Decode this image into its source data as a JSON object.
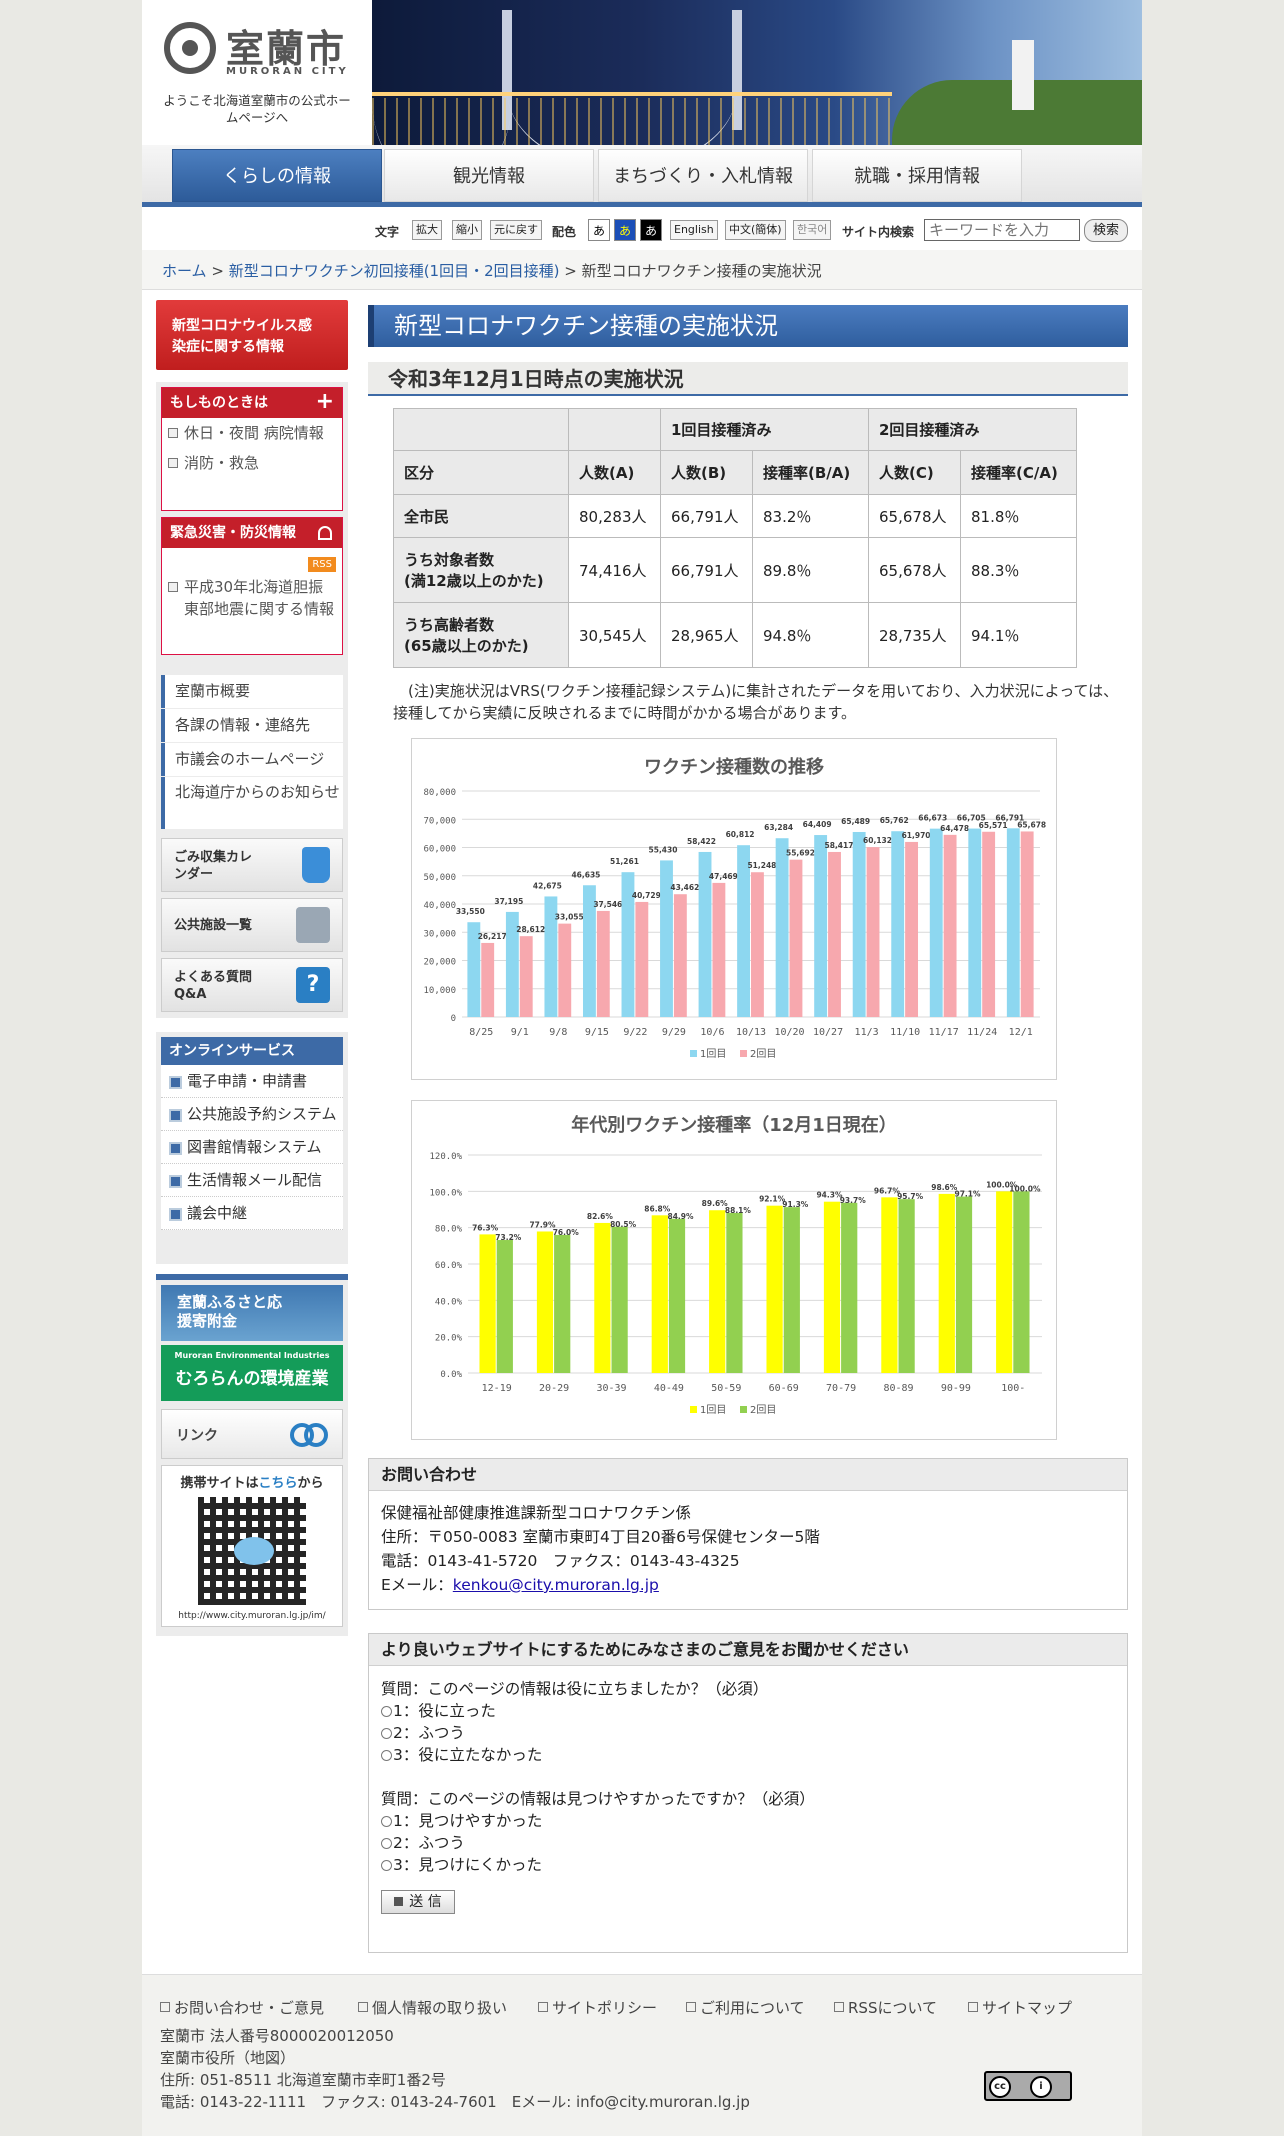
{
  "site": {
    "name": "室蘭市",
    "name_en": "MURORAN CITY",
    "welcome": "ようこそ北海道室蘭市の公式ホームページへ"
  },
  "gnav": [
    "くらしの情報",
    "観光情報",
    "まちづくり・入札情報",
    "就職・採用情報"
  ],
  "utility": {
    "text_label": "文字",
    "enlarge": "拡大",
    "shrink": "縮小",
    "reset": "元に戻す",
    "color_label": "配色",
    "color_options": [
      "あ",
      "あ",
      "あ"
    ],
    "english": "English",
    "chinese": "中文(簡体)",
    "korean": "한국어",
    "search_label": "サイト内検索",
    "search_placeholder": "キーワードを入力",
    "search_button": "検索"
  },
  "breadcrumb": {
    "home": "ホーム",
    "parent": "新型コロナワクチン初回接種(1回目・2回目接種)",
    "current": "新型コロナワクチン接種の実施状況",
    "sep": ">"
  },
  "sidebar": {
    "corona_banner": "新型コロナウイルス感染症に関する情報",
    "emergency_head": "もしものときは",
    "emergency_links": [
      "休日・夜間 病院情報",
      "消防・救急"
    ],
    "disaster_head": "緊急災害・防災情報",
    "rss": "RSS",
    "disaster_links": [
      "平成30年北海道胆振東部地震に関する情報"
    ],
    "menu": [
      "室蘭市概要",
      "各課の情報・連絡先",
      "市議会のホームページ",
      "北海道庁からのお知らせ"
    ],
    "banners": [
      "ごみ収集カレンダー",
      "公共施設一覧",
      "よくある質問Q&A"
    ],
    "online_head": "オンラインサービス",
    "online_links": [
      "電子申請・申請書",
      "公共施設予約システム",
      "図書館情報システム",
      "生活情報メール配信",
      "議会中継"
    ],
    "furusato": "室蘭ふるさと応援寄附金",
    "env_small": "Muroran Environmental Industries",
    "env_big": "むろらんの環境産業",
    "link_label": "リンク",
    "mobile_label_1": "携帯サイトは",
    "mobile_label_2": "こちら",
    "mobile_label_3": "から",
    "mobile_url": "http://www.city.muroran.lg.jp/im/"
  },
  "main": {
    "title": "新型コロナワクチン接種の実施状況",
    "subtitle": "令和3年12月1日時点の実施状況",
    "table": {
      "group_headers": [
        "1回目接種済み",
        "2回目接種済み"
      ],
      "headers": [
        "区分",
        "人数(A)",
        "人数(B)",
        "接種率(B/A)",
        "人数(C)",
        "接種率(C/A)"
      ],
      "rows": [
        {
          "label": "全市民",
          "sub": "",
          "cells": [
            "80,283人",
            "66,791人",
            "83.2％",
            "65,678人",
            "81.8％"
          ]
        },
        {
          "label": "うち対象者数",
          "sub": "(満12歳以上のかた)",
          "cells": [
            "74,416人",
            "66,791人",
            "89.8％",
            "65,678人",
            "88.3％"
          ]
        },
        {
          "label": "うち高齢者数",
          "sub": "(65歳以上のかた)",
          "cells": [
            "30,545人",
            "28,965人",
            "94.8％",
            "28,735人",
            "94.1％"
          ]
        }
      ]
    },
    "note": "(注)実施状況はVRS(ワクチン接種記録システム)に集計されたデータを用いており、入力状況によっては、接種してから実績に反映されるまでに時間がかかる場合があります。"
  },
  "contact": {
    "head": "お問い合わせ",
    "dept": "保健福祉部健康推進課新型コロナワクチン係",
    "address": "住所：〒050-0083 室蘭市東町4丁目20番6号保健センター5階",
    "phone": "電話：0143-41-5720　ファクス：0143-43-4325",
    "email_label": "Eメール：",
    "email": "kenkou@city.muroran.lg.jp"
  },
  "survey": {
    "head": "より良いウェブサイトにするためにみなさまのご意見をお聞かせください",
    "q1": "質問：このページの情報は役に立ちましたか？（必須）",
    "q1_options": [
      "1：役に立った",
      "2：ふつう",
      "3：役に立たなかった"
    ],
    "q2": "質問：このページの情報は見つけやすかったですか？（必須）",
    "q2_options": [
      "1：見つけやすかった",
      "2：ふつう",
      "3：見つけにくかった"
    ],
    "submit": "送 信"
  },
  "footer": {
    "links": [
      "お問い合わせ・ご意見",
      "個人情報の取り扱い",
      "サイトポリシー",
      "ご利用について",
      "RSSについて",
      "サイトマップ"
    ],
    "corp_no": "室蘭市 法人番号8000020012050",
    "office": "室蘭市役所（地図）",
    "address": "住所: 051-8511 北海道室蘭市幸町1番2号",
    "phone": "電話: 0143-22-1111　ファクス: 0143-24-7601　Eメール: info@city.muroran.lg.jp"
  },
  "colors": {
    "accent": "#3d6aa6",
    "alert": "#c41f2a",
    "bar1_cyan": "#8dd7f0",
    "bar2_pink": "#f7a8ae",
    "bar1_yellow": "#ffff00",
    "bar2_green": "#92d050"
  },
  "chart_data": [
    {
      "type": "bar",
      "title": "ワクチン接種数の推移",
      "categories": [
        "8/25",
        "9/1",
        "9/8",
        "9/15",
        "9/22",
        "9/29",
        "10/6",
        "10/13",
        "10/20",
        "10/27",
        "11/3",
        "11/10",
        "11/17",
        "11/24",
        "12/1"
      ],
      "series": [
        {
          "name": "1回目",
          "values": [
            33550,
            37195,
            42675,
            46635,
            51261,
            55430,
            58422,
            60812,
            63284,
            64409,
            65489,
            65762,
            66673,
            66705,
            66791
          ]
        },
        {
          "name": "2回目",
          "values": [
            26217,
            28612,
            33055,
            37546,
            40729,
            43462,
            47469,
            51248,
            55692,
            58417,
            60132,
            61970,
            64478,
            65571,
            65678
          ]
        }
      ],
      "ylim": [
        0,
        80000
      ],
      "yticks": [
        "0",
        "10,000",
        "20,000",
        "30,000",
        "40,000",
        "50,000",
        "60,000",
        "70,000",
        "80,000"
      ],
      "legend": "bottom"
    },
    {
      "type": "bar",
      "title": "年代別ワクチン接種率（12月1日現在）",
      "categories": [
        "12-19",
        "20-29",
        "30-39",
        "40-49",
        "50-59",
        "60-69",
        "70-79",
        "80-89",
        "90-99",
        "100-"
      ],
      "series": [
        {
          "name": "1回目",
          "values": [
            76.3,
            77.9,
            82.6,
            86.8,
            89.6,
            92.1,
            94.3,
            96.7,
            98.6,
            100.0
          ]
        },
        {
          "name": "2回目",
          "values": [
            73.2,
            76.0,
            80.5,
            84.9,
            88.1,
            91.3,
            93.7,
            95.7,
            97.1,
            100.0
          ]
        }
      ],
      "ylim": [
        0,
        120
      ],
      "yticks": [
        "0.0%",
        "20.0%",
        "40.0%",
        "60.0%",
        "80.0%",
        "100.0%",
        "120.0%"
      ],
      "legend": "bottom"
    }
  ]
}
